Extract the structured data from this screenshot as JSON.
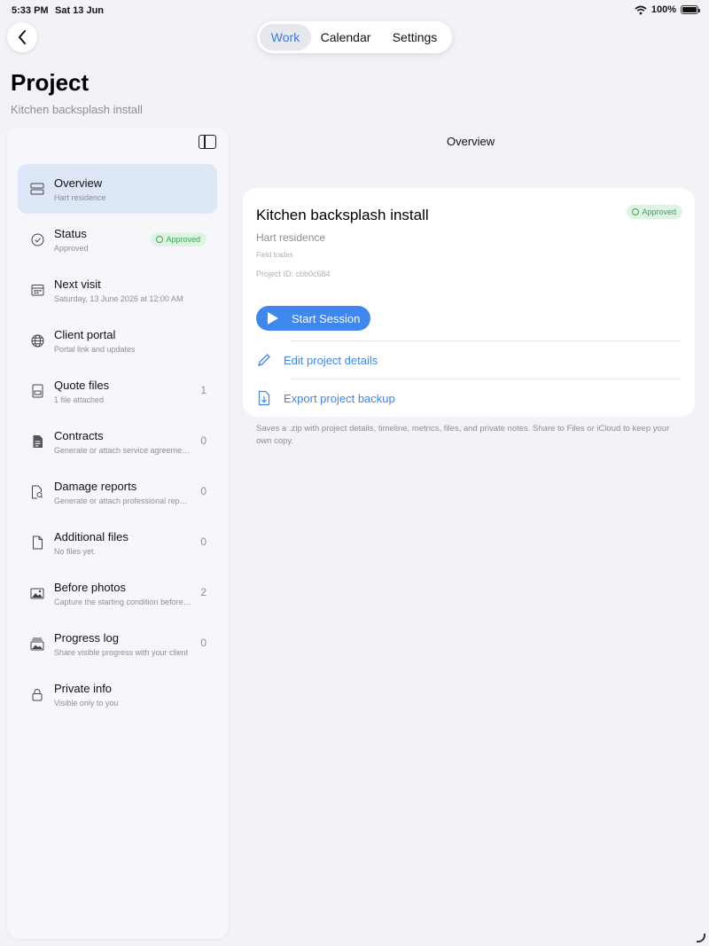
{
  "status_bar": {
    "time": "5:33 PM",
    "date": "Sat 13 Jun",
    "battery": "100%"
  },
  "nav": {
    "tabs": [
      {
        "label": "Work",
        "active": true
      },
      {
        "label": "Calendar",
        "active": false
      },
      {
        "label": "Settings",
        "active": false
      }
    ]
  },
  "header": {
    "title": "Project",
    "subtitle": "Kitchen backsplash install"
  },
  "sidebar": {
    "items": [
      {
        "label": "Overview",
        "sub": "Hart residence",
        "icon": "server-stack-icon",
        "selected": true
      },
      {
        "label": "Status",
        "sub": "Approved",
        "icon": "check-circle-icon",
        "badge": "Approved"
      },
      {
        "label": "Next visit",
        "sub": "Saturday, 13 June 2026 at 12:00 AM",
        "icon": "calendar-icon"
      },
      {
        "label": "Client portal",
        "sub": "Portal link and updates",
        "icon": "globe-icon"
      },
      {
        "label": "Quote files",
        "sub": "1 file attached",
        "icon": "quote-file-icon",
        "count": "1"
      },
      {
        "label": "Contracts",
        "sub": "Generate or attach service agreements",
        "icon": "contract-doc-icon",
        "count": "0"
      },
      {
        "label": "Damage reports",
        "sub": "Generate or attach professional reports",
        "icon": "search-doc-icon",
        "count": "0"
      },
      {
        "label": "Additional files",
        "sub": "No files yet.",
        "icon": "file-icon",
        "count": "0"
      },
      {
        "label": "Before photos",
        "sub": "Capture the starting condition before work",
        "icon": "photo-icon",
        "count": "2"
      },
      {
        "label": "Progress log",
        "sub": "Share visible progress with your client",
        "icon": "photo-stack-icon",
        "count": "0"
      },
      {
        "label": "Private info",
        "sub": "Visible only to you",
        "icon": "lock-icon"
      }
    ]
  },
  "detail": {
    "title": "Overview",
    "card": {
      "title": "Kitchen backsplash install",
      "client": "Hart residence",
      "trade": "Field trades",
      "project_id": "Project ID: cbb0c684",
      "badge": "Approved",
      "start_label": "Start Session",
      "edit_label": "Edit project details",
      "export_label": "Export project backup"
    },
    "footnote": "Saves a .zip with project details, timeline, metrics, files, and private notes. Share to Files or iCloud to keep your own copy."
  },
  "colors": {
    "accent": "#3f86ee",
    "approved": "#34a853",
    "selected_bg": "#dde7f7"
  }
}
